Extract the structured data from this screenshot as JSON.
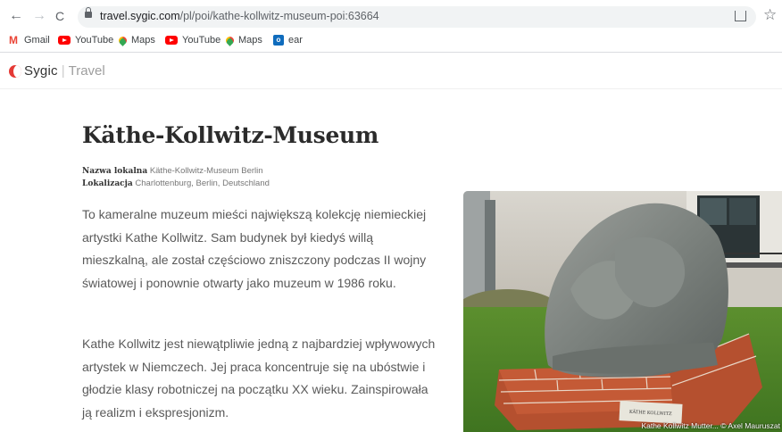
{
  "browser": {
    "url_domain": "travel.sygic.com",
    "url_path": "/pl/poi/kathe-kollwitz-museum-poi:63664",
    "back_glyph": "←",
    "forward_glyph": "→",
    "reload_glyph": "C",
    "star_glyph": "☆",
    "bookmarks": [
      {
        "label": "Gmail",
        "icon": "gmail-icon"
      },
      {
        "label": "YouTube",
        "icon": "youtube-icon"
      },
      {
        "label": "Maps",
        "icon": "maps-icon"
      },
      {
        "label": "YouTube",
        "icon": "youtube-icon"
      },
      {
        "label": "Maps",
        "icon": "maps-icon"
      },
      {
        "label": "ear",
        "icon": "outlook-icon"
      }
    ],
    "outlook_letter": "o"
  },
  "site": {
    "brand": "Sygic",
    "separator": "|",
    "product": "Travel"
  },
  "poi": {
    "title": "Käthe-Kollwitz-Museum",
    "local_name_label": "Nazwa lokalna",
    "local_name_value": "Käthe-Kollwitz-Museum Berlin",
    "location_label": "Lokalizacja",
    "location_value": "Charlottenburg, Berlin, Deutschland",
    "description": [
      "To kameralne muzeum mieści największą kolekcję niemieckiej artystki Kathe Kollwitz. Sam budynek był kiedyś willą mieszkalną, ale został częściowo zniszczony podczas II wojny światowej i ponownie otwarty jako muzeum w 1986 roku.",
      "Kathe Kollwitz jest niewątpliwie jedną z najbardziej wpływowych artystek w Niemczech. Jej praca koncentruje się na ubóstwie i głodzie klasy robotniczej na początku XX wieku. Zainspirowała ją realizm i ekspresjonizm."
    ],
    "photo_caption": "Kathe Kollwitz Mutter... © Axel Mauruszat",
    "plaque_text": "KÄTHE KOLLWITZ"
  },
  "colors": {
    "brand_red": "#e53935",
    "text_grey": "#5a5a5a"
  }
}
